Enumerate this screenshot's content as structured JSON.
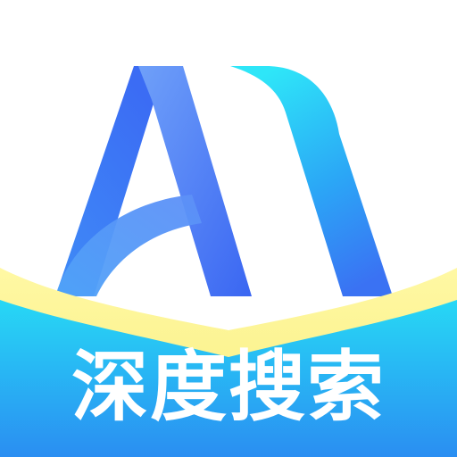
{
  "app": {
    "name": "深度搜索",
    "logo_letters": "AI",
    "logo_icon": "ai-book-logo-icon"
  },
  "colors": {
    "background": "#ffffff",
    "brand_blue": "#3b6cf6",
    "brand_cyan": "#27e0f7",
    "book_yellow": "#fbf48e",
    "book_blue": "#1fb4f2",
    "text": "#ffffff"
  }
}
